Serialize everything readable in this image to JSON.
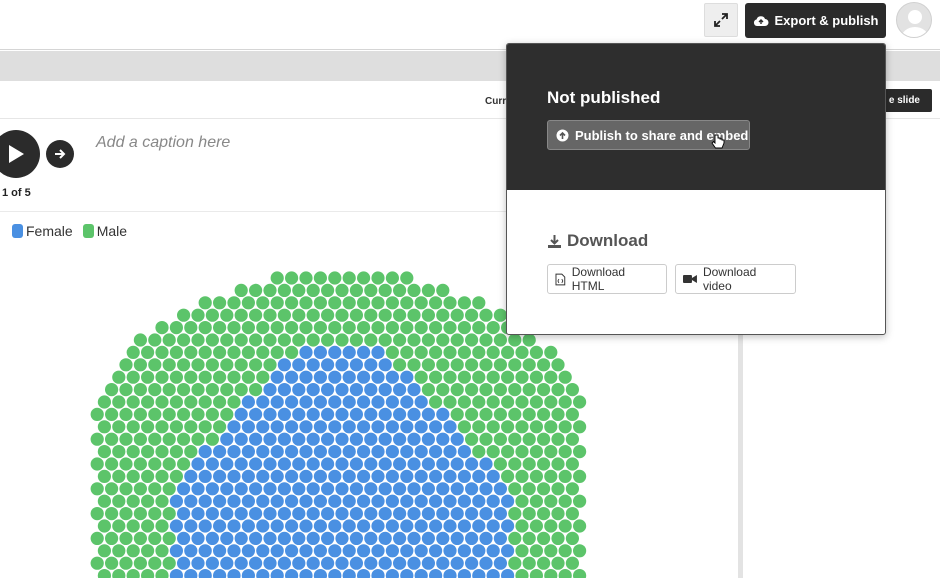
{
  "topbar": {
    "expand_icon": "expand-arrows-icon",
    "export_label": "Export & publish",
    "export_icon": "cloud-upload-icon",
    "avatar_icon": "user-avatar-icon"
  },
  "slidebar": {
    "current_label": "Curr",
    "slide_button_label": "e slide"
  },
  "story": {
    "caption_placeholder": "Add a caption here",
    "slide_counter": "1 of 5"
  },
  "legend": [
    {
      "label": "Female",
      "color": "#4a90e2"
    },
    {
      "label": "Male",
      "color": "#5cc46a"
    }
  ],
  "publish_panel": {
    "status_title": "Not published",
    "publish_button_label": "Publish to share and embed",
    "download_title": "Download",
    "download_html_label": "Download HTML",
    "download_video_label": "Download video"
  },
  "colors": {
    "female": "#4a90e2",
    "male": "#5cc46a",
    "dark": "#2b2b2b"
  }
}
